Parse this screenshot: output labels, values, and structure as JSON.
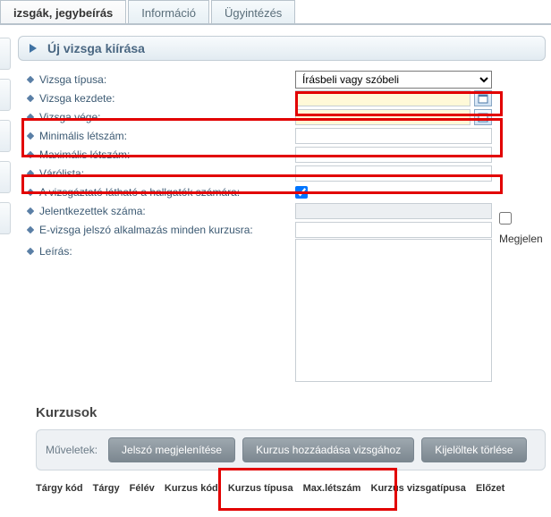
{
  "tabs": {
    "active": "izsgák, jegybeírás",
    "info": "Információ",
    "admin": "Ügyintézés"
  },
  "accordion": {
    "title": "Új vizsga kiírása"
  },
  "labels": {
    "exam_type": "Vizsga típusa:",
    "exam_start": "Vizsga kezdete:",
    "exam_end": "Vizsga vége:",
    "min_headcount": "Minimális létszám:",
    "max_headcount": "Maximális létszám:",
    "waitlist": "Várólista:",
    "visible_to_students": "A vizsgáztató látható a hallgatók számára:",
    "signed_up_count": "Jelentkezettek száma:",
    "evizsga_password": "E-vizsga jelszó alkalmazás minden kurzusra:",
    "show_label": "Megjelen",
    "description": "Leírás:"
  },
  "values": {
    "exam_type_selected": "Írásbeli vagy szóbeli",
    "exam_start": "",
    "exam_end": "",
    "min_headcount": "",
    "max_headcount": "",
    "waitlist": "",
    "signed_up_count": "",
    "evizsga_password": "",
    "description": "",
    "visible_checked": true,
    "megjelen_checked": false
  },
  "placeholders": {
    "date": ""
  },
  "courses": {
    "section_title": "Kurzusok",
    "operations_label": "Műveletek:",
    "buttons": {
      "show_password": "Jelszó megjelenítése",
      "add_course": "Kurzus hozzáadása vizsgához",
      "delete_selected": "Kijelöltek törlése"
    },
    "columns": [
      "Tárgy kód",
      "Tárgy",
      "Félév",
      "Kurzus kód",
      "Kurzus típusa",
      "Max.létszám",
      "Kurzus vizsgatípusa",
      "Előzet"
    ]
  },
  "icons": {
    "chevron": "chevron-right-icon",
    "diamond": "diamond-icon",
    "calendar": "calendar-icon"
  },
  "colors": {
    "highlight": "#e20000",
    "diamond": "#5a7fa6",
    "header_text": "#4a6782"
  }
}
